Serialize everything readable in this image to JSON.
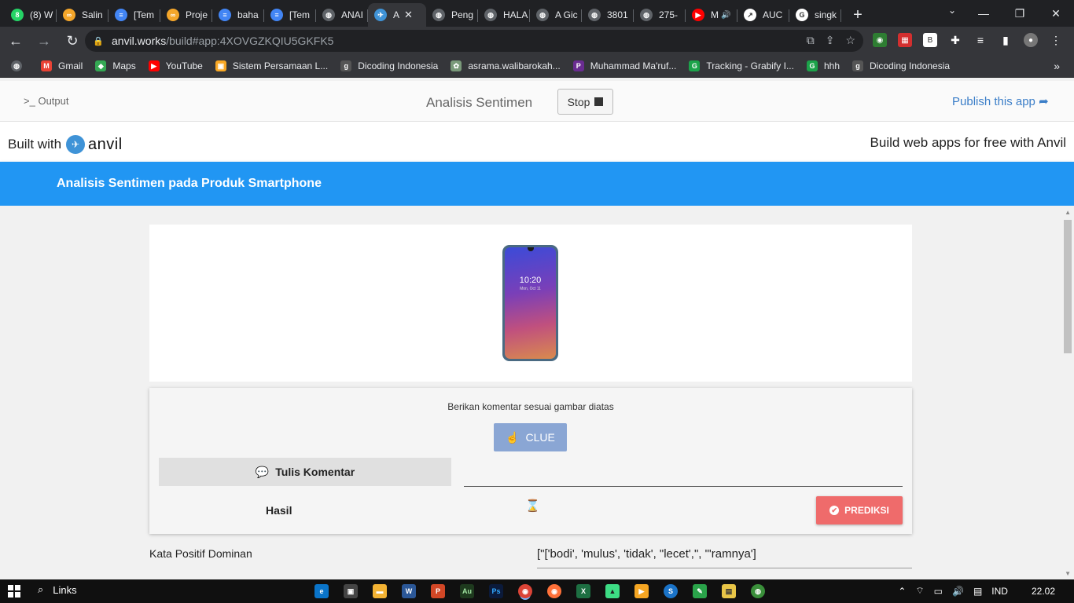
{
  "browser": {
    "tabs": [
      {
        "label": "(8) W",
        "icon": "whatsapp-icon",
        "color": "#25d366",
        "glyph": "8"
      },
      {
        "label": "Salin",
        "icon": "infinity-icon",
        "color": "#f4a62a",
        "glyph": "∞"
      },
      {
        "label": "[Tem",
        "icon": "docs-icon",
        "color": "#4285f4",
        "glyph": "≡"
      },
      {
        "label": "Proje",
        "icon": "infinity-icon",
        "color": "#f4a62a",
        "glyph": "∞"
      },
      {
        "label": "baha",
        "icon": "docs-icon",
        "color": "#4285f4",
        "glyph": "≡"
      },
      {
        "label": "[Tem",
        "icon": "docs-icon",
        "color": "#4285f4",
        "glyph": "≡"
      },
      {
        "label": "ANAI",
        "icon": "globe-icon",
        "color": "#5f6368",
        "glyph": "◍"
      },
      {
        "label": "A",
        "icon": "anvil-icon",
        "color": "#3f93d7",
        "glyph": "✈",
        "active": true
      },
      {
        "label": "Peng",
        "icon": "globe-icon",
        "color": "#5f6368",
        "glyph": "◍"
      },
      {
        "label": "HALA",
        "icon": "globe-icon",
        "color": "#5f6368",
        "glyph": "◍"
      },
      {
        "label": "A Gic",
        "icon": "globe-icon",
        "color": "#5f6368",
        "glyph": "◍"
      },
      {
        "label": "3801",
        "icon": "globe-icon",
        "color": "#5f6368",
        "glyph": "◍"
      },
      {
        "label": "275-",
        "icon": "globe-icon",
        "color": "#5f6368",
        "glyph": "◍"
      },
      {
        "label": "M",
        "icon": "youtube-icon",
        "color": "#ff0000",
        "glyph": "▶",
        "audio": true
      },
      {
        "label": "AUC",
        "icon": "chart-icon",
        "color": "#ffffff",
        "glyph": "↗"
      },
      {
        "label": "singk",
        "icon": "google-icon",
        "color": "#ffffff",
        "glyph": "G"
      }
    ],
    "close_glyph": "✕",
    "newtab_glyph": "+",
    "url_host": "anvil.works",
    "url_path": "/build#app:4XOVGZKQIU5GKFK5",
    "bookmarks": [
      {
        "label": "Gmail",
        "icon": "gmail-icon",
        "color": "#ea4335",
        "glyph": "M"
      },
      {
        "label": "Maps",
        "icon": "maps-icon",
        "color": "#34a853",
        "glyph": "◆"
      },
      {
        "label": "YouTube",
        "icon": "youtube-icon",
        "color": "#ff0000",
        "glyph": "▶"
      },
      {
        "label": "Sistem Persamaan L...",
        "icon": "bookmark-site-icon",
        "color": "#f9a825",
        "glyph": "▣"
      },
      {
        "label": "Dicoding Indonesia",
        "icon": "dicoding-icon",
        "color": "#555555",
        "glyph": "g"
      },
      {
        "label": "asrama.walibarokah...",
        "icon": "site-icon",
        "color": "#7a9a7a",
        "glyph": "✿"
      },
      {
        "label": "Muhammad Ma'ruf...",
        "icon": "p-icon",
        "color": "#6a2c91",
        "glyph": "P"
      },
      {
        "label": "Tracking - Grabify I...",
        "icon": "grabify-icon",
        "color": "#1ca34a",
        "glyph": "G"
      },
      {
        "label": "hhh",
        "icon": "grabify-icon",
        "color": "#1ca34a",
        "glyph": "G"
      },
      {
        "label": "Dicoding Indonesia",
        "icon": "dicoding-icon",
        "color": "#555555",
        "glyph": "g"
      }
    ]
  },
  "ide": {
    "output_label": "Output",
    "output_glyph": ">_",
    "app_name": "Analisis Sentimen",
    "stop_label": "Stop",
    "publish_label": "Publish this app",
    "publish_glyph": "➦"
  },
  "built": {
    "built_with": "Built with",
    "logo_word": "anvil",
    "build_free": "Build web apps for free with Anvil"
  },
  "app": {
    "title": "Analisis Sentimen pada Produk Smartphone",
    "phone_time": "10:20",
    "phone_date": "Mon, Oct 11",
    "instruction": "Berikan komentar sesuai gambar diatas",
    "clue_label": "CLUE",
    "tulis_label": "Tulis Komentar",
    "komentar_value": "",
    "hasil_label": "Hasil",
    "prediksi_label": "PREDIKSI",
    "kata_label": "Kata Positif Dominan",
    "kata_value": "[\"['bodi', 'mulus', 'tidak', \"lecet',\", \"'ramnya']"
  },
  "taskbar": {
    "search_label": "Links",
    "lang": "IND",
    "time": "22.02"
  },
  "colors": {
    "appbar": "#2196f3",
    "clue": "#8aa6d4",
    "prediksi": "#ef6b6b",
    "publish": "#3b7ec8"
  }
}
